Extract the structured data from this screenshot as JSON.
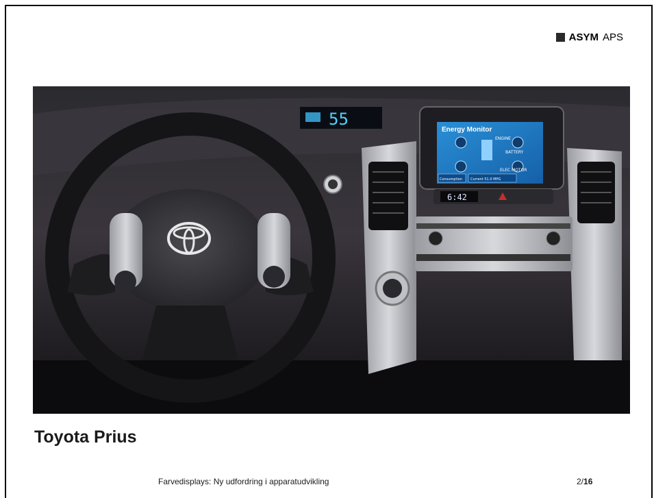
{
  "logo": {
    "strong": "ASYM",
    "light": "APS"
  },
  "photo": {
    "screen_title": "Energy Monitor",
    "screen_labels": {
      "engine": "ENGINE",
      "battery": "BATTERY",
      "motor": "ELEC MOTOR"
    },
    "screen_buttons": {
      "consumption": "Consumption",
      "current": "Current  51.0 MPG"
    },
    "clock": "6:42",
    "speedo": "55"
  },
  "title": "Toyota Prius",
  "footer": {
    "text": "Farvedisplays: Ny udfordring i apparatudvikling",
    "page_current": "2/",
    "page_total": "16"
  }
}
